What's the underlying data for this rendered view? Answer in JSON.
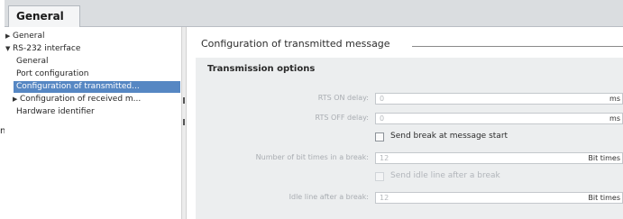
{
  "stray_text": "n",
  "tab": {
    "label": "General"
  },
  "tree": {
    "items": [
      {
        "label": "General",
        "arrow": "▶"
      },
      {
        "label": "RS-232 interface",
        "arrow": "▼"
      },
      {
        "label": "General",
        "arrow": ""
      },
      {
        "label": "Port configuration",
        "arrow": ""
      },
      {
        "label": "Configuration of transmitted...",
        "arrow": ""
      },
      {
        "label": "Configuration of received m...",
        "arrow": "▶"
      },
      {
        "label": "Hardware identifier",
        "arrow": ""
      }
    ]
  },
  "section": {
    "title": "Configuration of transmitted message"
  },
  "panel": {
    "title": "Transmission options"
  },
  "fields": {
    "rts_on": {
      "label": "RTS ON delay:",
      "value": "0",
      "unit": "ms"
    },
    "rts_off": {
      "label": "RTS OFF delay:",
      "value": "0",
      "unit": "ms"
    },
    "break_bits": {
      "label": "Number of bit times in a break:",
      "value": "12",
      "unit": "Bit times"
    },
    "idle_line": {
      "label": "Idle line after a break:",
      "value": "12",
      "unit": "Bit times"
    }
  },
  "checks": {
    "send_break": {
      "label": "Send break at message start",
      "checked": false,
      "enabled": true
    },
    "send_idle": {
      "label": "Send idle line after a break",
      "checked": false,
      "enabled": false
    }
  }
}
